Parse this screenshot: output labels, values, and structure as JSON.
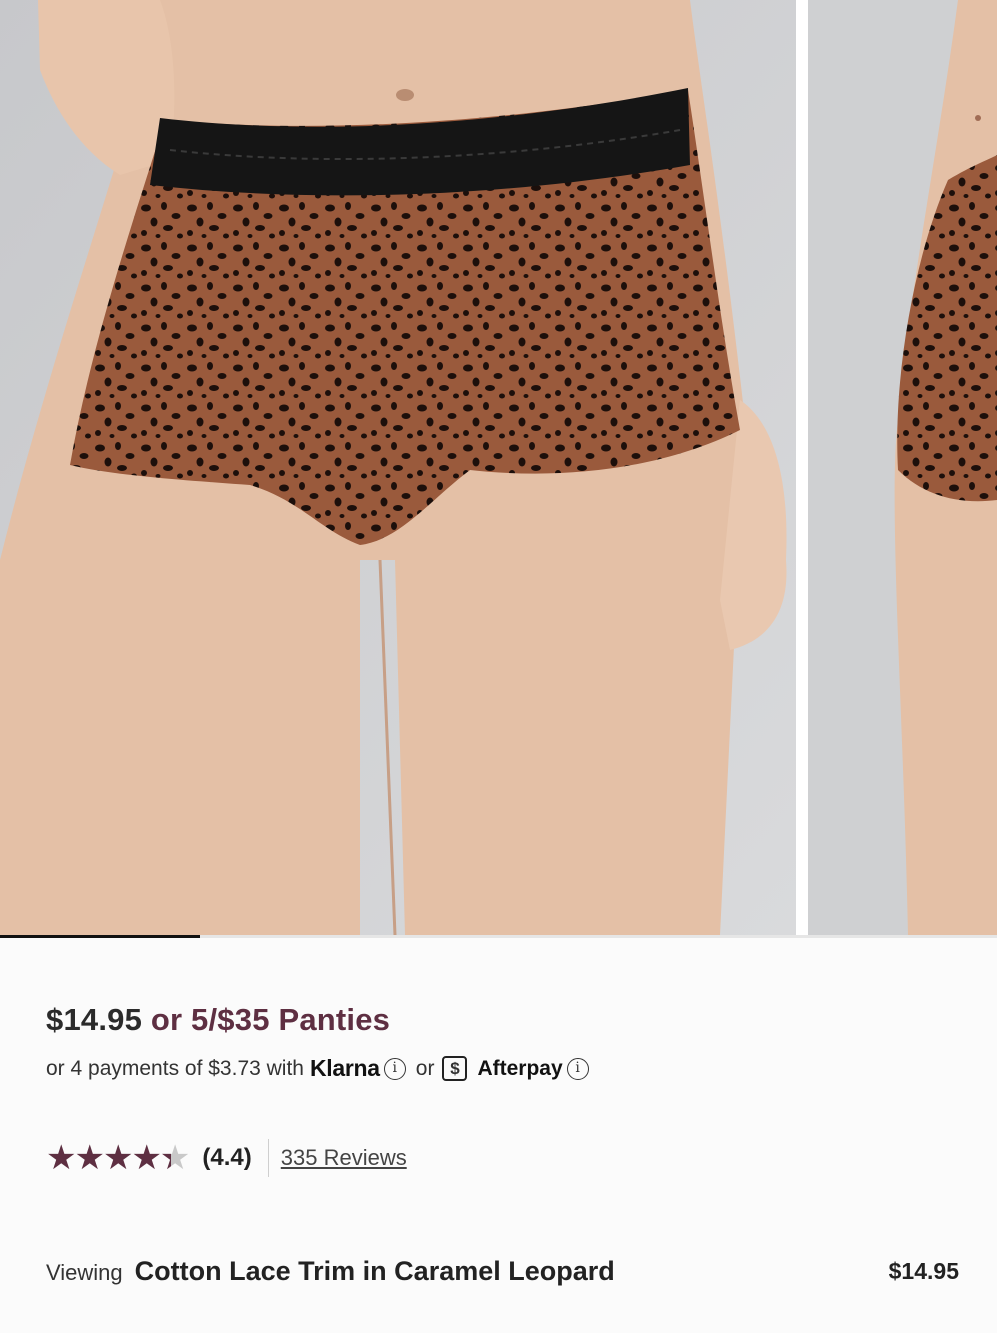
{
  "gallery": {
    "images": [
      {
        "name": "product-photo-front"
      },
      {
        "name": "product-photo-side"
      }
    ],
    "active_index": 0
  },
  "product": {
    "price": "$14.95",
    "promo_text": " or 5/$35 Panties",
    "payments": {
      "prefix": "or 4 payments of $3.73 with",
      "klarna_label": "Klarna",
      "or_text": "or",
      "afterpay_symbol": "$",
      "afterpay_label": "Afterpay",
      "info_glyph": "i"
    },
    "rating": {
      "value": 4.4,
      "value_label": "(4.4)",
      "reviews_label": "335 Reviews",
      "max": 5
    },
    "viewing": {
      "label": "Viewing",
      "variant_name": "Cotton Lace Trim in Caramel Leopard",
      "variant_price": "$14.95"
    }
  },
  "colors": {
    "accent": "#5e2f42",
    "fabric": "#9a5a3c",
    "lace": "#151515"
  }
}
